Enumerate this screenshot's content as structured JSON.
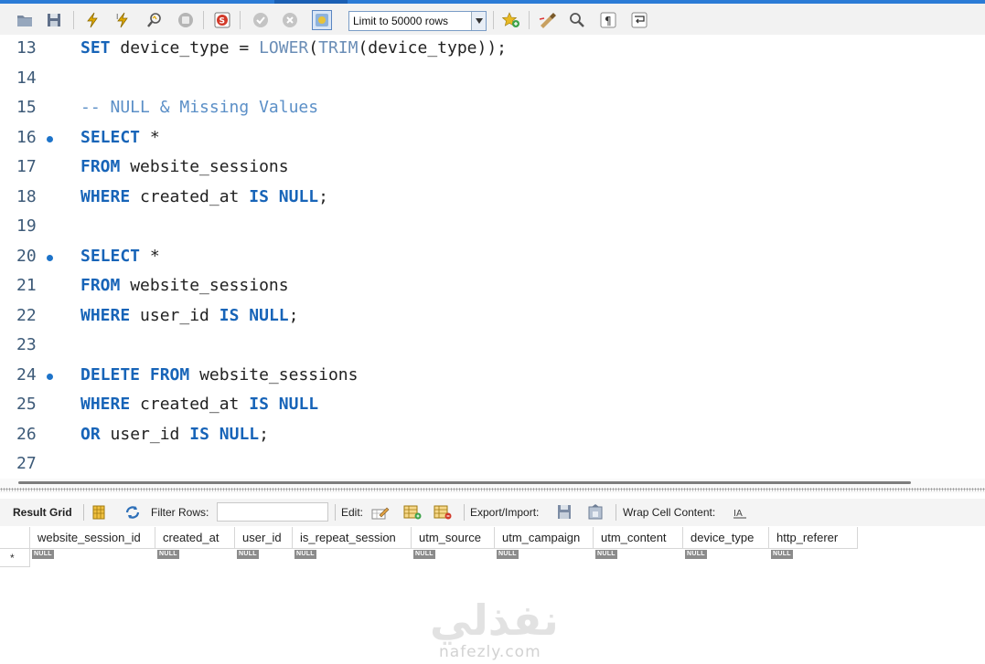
{
  "toolbar": {
    "limit_label": "Limit to 50000 rows",
    "icons": [
      "folder-icon",
      "save-icon",
      "lightning-icon",
      "lightning-cursor-icon",
      "magnifier-explain-icon",
      "stop-icon",
      "toggle-error-icon",
      "commit-icon",
      "rollback-icon",
      "autocommit-icon",
      "bookmark-add-icon",
      "beautify-icon",
      "find-icon",
      "invisible-chars-icon",
      "wrap-lines-icon"
    ]
  },
  "editor": {
    "lines": [
      {
        "n": "13",
        "dot": false
      },
      {
        "n": "14",
        "dot": false
      },
      {
        "n": "15",
        "dot": false
      },
      {
        "n": "16",
        "dot": true
      },
      {
        "n": "17",
        "dot": false
      },
      {
        "n": "18",
        "dot": false
      },
      {
        "n": "19",
        "dot": false
      },
      {
        "n": "20",
        "dot": true
      },
      {
        "n": "21",
        "dot": false
      },
      {
        "n": "22",
        "dot": false
      },
      {
        "n": "23",
        "dot": false
      },
      {
        "n": "24",
        "dot": true
      },
      {
        "n": "25",
        "dot": false
      },
      {
        "n": "26",
        "dot": false
      },
      {
        "n": "27",
        "dot": false
      }
    ],
    "tokens": {
      "l13": [
        "SET",
        " device_type = ",
        "LOWER",
        "(",
        "TRIM",
        "(device_type));"
      ],
      "l15": [
        "-- NULL & Missing Values"
      ],
      "l16": [
        "SELECT",
        " *"
      ],
      "l17": [
        "FROM",
        " website_sessions"
      ],
      "l18": [
        "WHERE",
        " created_at ",
        "IS",
        " ",
        "NULL",
        ";"
      ],
      "l20": [
        "SELECT",
        " *"
      ],
      "l21": [
        "FROM",
        " website_sessions"
      ],
      "l22": [
        "WHERE",
        " user_id ",
        "IS",
        " ",
        "NULL",
        ";"
      ],
      "l24": [
        "DELETE",
        " ",
        "FROM",
        " website_sessions"
      ],
      "l25": [
        "WHERE",
        " created_at ",
        "IS",
        " ",
        "NULL"
      ],
      "l26": [
        "OR",
        " user_id ",
        "IS",
        " ",
        "NULL",
        ";"
      ]
    }
  },
  "result_toolbar": {
    "result_grid": "Result Grid",
    "filter_rows": "Filter Rows:",
    "edit": "Edit:",
    "export_import": "Export/Import:",
    "wrap_cell": "Wrap Cell Content:"
  },
  "grid": {
    "columns": [
      "website_session_id",
      "created_at",
      "user_id",
      "is_repeat_session",
      "utm_source",
      "utm_campaign",
      "utm_content",
      "device_type",
      "http_referer"
    ],
    "null_label": "NULL",
    "row_marker": "*"
  },
  "watermark": {
    "logo": "نفذلي",
    "url": "nafezly.com"
  }
}
